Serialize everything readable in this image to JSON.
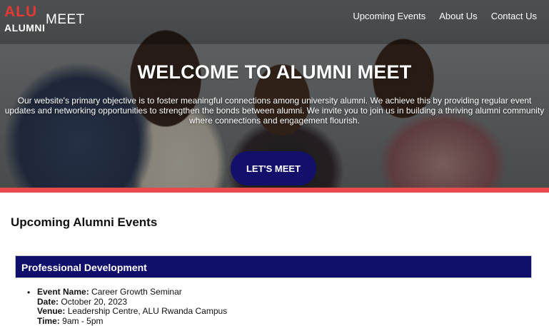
{
  "header": {
    "logo_top": "ALU",
    "logo_bottom": "ALUMNI",
    "brand": "MEET",
    "nav": [
      "Upcoming Events",
      "About Us",
      "Contact Us"
    ]
  },
  "hero": {
    "title": "WELCOME TO ALUMNI MEET",
    "description": "Our website's primary objective is to foster meaningful connections among university alumni. We achieve this by providing regular event updates and networking opportunities to strengthen the bonds between alumni. We invite you to join us in building a thriving alumni community where connections and engagement flourish.",
    "cta": "LET'S MEET"
  },
  "events_section": {
    "title": "Upcoming Alumni Events",
    "category": "Professional Development",
    "event": {
      "name_label": "Event Name:",
      "name": "Career Growth Seminar",
      "date_label": "Date:",
      "date": "October 20, 2023",
      "venue_label": "Venue:",
      "venue": "Leadership Centre, ALU Rwanda Campus",
      "time_label": "Time:",
      "time": "9am - 5pm"
    }
  },
  "colors": {
    "accent_navy": "#12106b",
    "accent_red": "#e84b4b",
    "logo_red": "#e53935"
  }
}
